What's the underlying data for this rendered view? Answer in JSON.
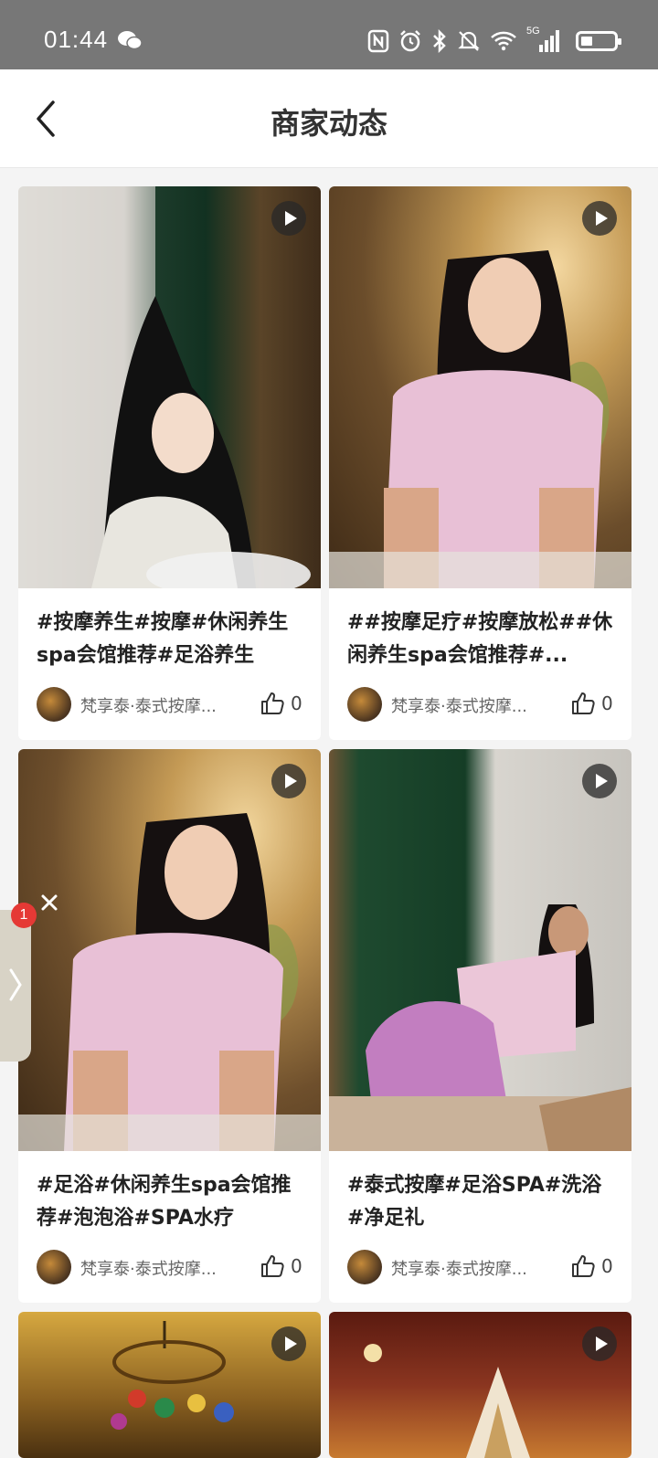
{
  "status": {
    "time": "01:44",
    "network": "5G"
  },
  "header": {
    "title": "商家动态"
  },
  "cards": [
    {
      "caption": "#按摩养生#按摩#休闲养生spa会馆推荐#足浴养生",
      "shop": "梵享泰·泰式按摩...",
      "likes": "0"
    },
    {
      "caption": "##按摩足疗#按摩放松##休闲养生spa会馆推荐#...",
      "shop": "梵享泰·泰式按摩...",
      "likes": "0"
    },
    {
      "caption": "#足浴#休闲养生spa会馆推荐#泡泡浴#SPA水疗",
      "shop": "梵享泰·泰式按摩...",
      "likes": "0"
    },
    {
      "caption": "#泰式按摩#足浴SPA#洗浴#净足礼",
      "shop": "梵享泰·泰式按摩...",
      "likes": "0"
    }
  ],
  "floating": {
    "badge_count": "1"
  },
  "colors": {
    "statusbar_bg": "#777777",
    "badge": "#e53935"
  }
}
